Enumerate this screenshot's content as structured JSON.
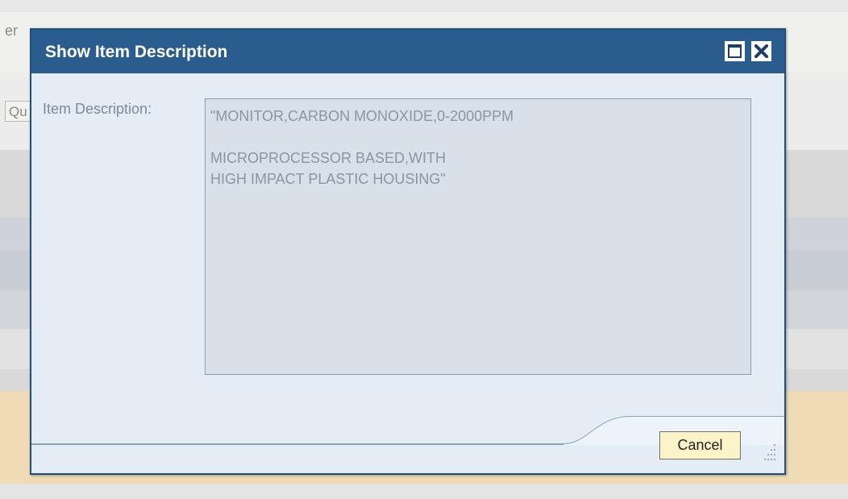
{
  "background": {
    "partial_text": "er",
    "button_fragment": "Qu"
  },
  "dialog": {
    "title": "Show Item Description",
    "maximize_icon": "maximize-icon",
    "close_icon": "close-icon",
    "field_label": "Item Description:",
    "description_value": "\"MONITOR,CARBON MONOXIDE,0-2000PPM\n\nMICROPROCESSOR BASED,WITH\nHIGH IMPACT PLASTIC HOUSING\"",
    "cancel_label": "Cancel",
    "resize_icon": "resize-grip-icon"
  },
  "colors": {
    "titlebar": "#2b5c8e",
    "dialog_body": "#e4ecf6",
    "cancel_button": "#fbf4c8"
  }
}
